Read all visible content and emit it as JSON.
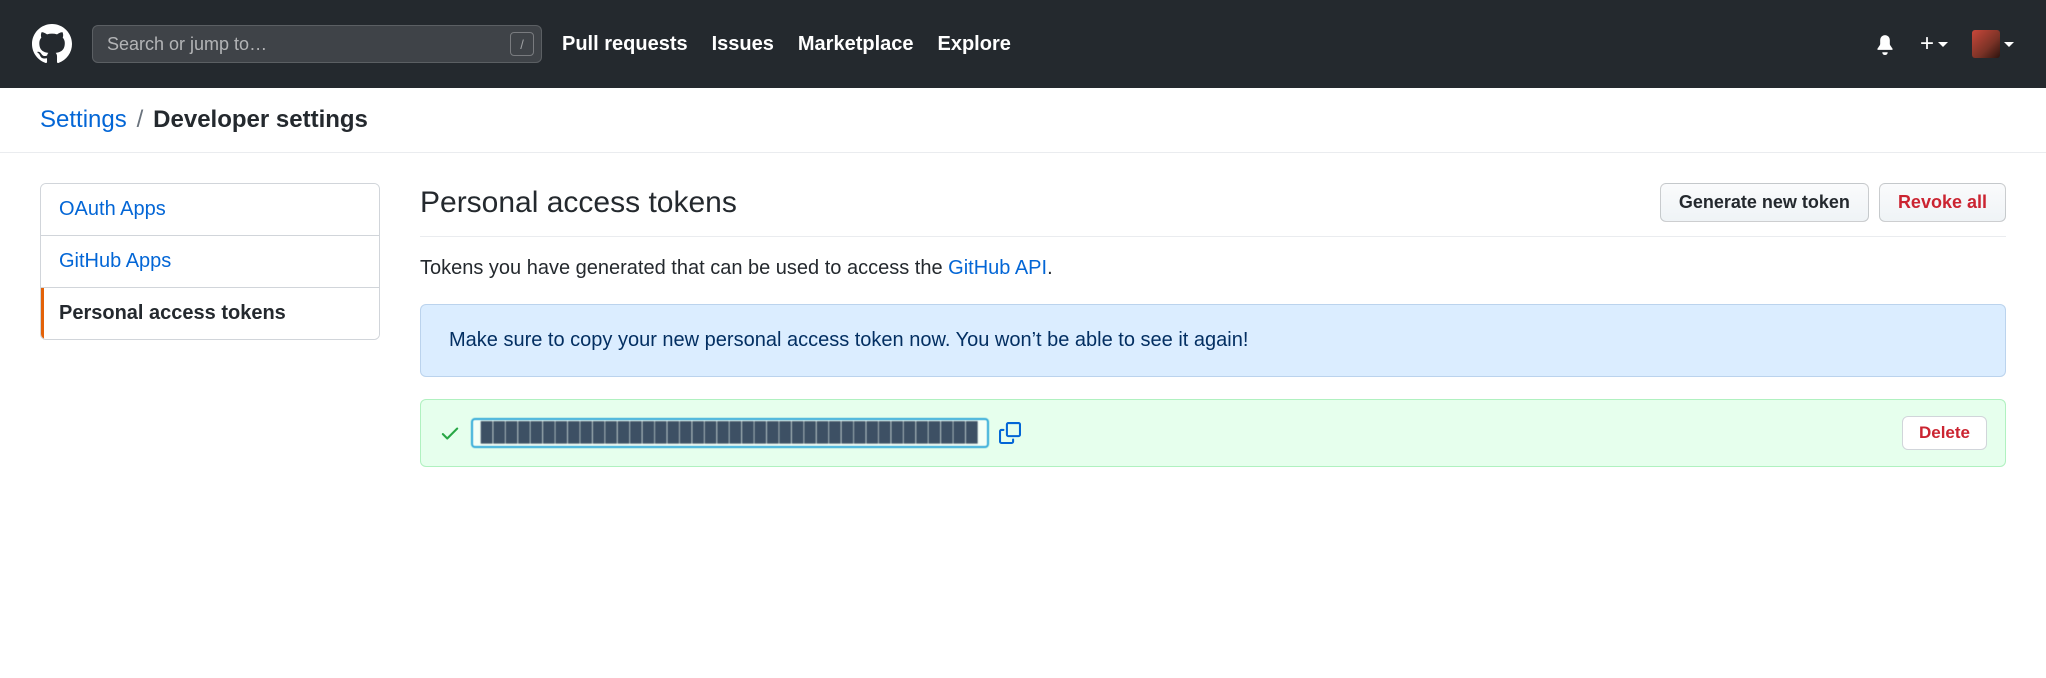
{
  "header": {
    "search_placeholder": "Search or jump to…",
    "nav": [
      "Pull requests",
      "Issues",
      "Marketplace",
      "Explore"
    ]
  },
  "breadcrumb": {
    "parent": "Settings",
    "separator": "/",
    "current": "Developer settings"
  },
  "sidebar": {
    "items": [
      {
        "label": "OAuth Apps",
        "active": false
      },
      {
        "label": "GitHub Apps",
        "active": false
      },
      {
        "label": "Personal access tokens",
        "active": true
      }
    ]
  },
  "main": {
    "title": "Personal access tokens",
    "generate_label": "Generate new token",
    "revoke_label": "Revoke all",
    "intro_prefix": "Tokens you have generated that can be used to access the ",
    "intro_link": "GitHub API",
    "intro_suffix": ".",
    "flash": "Make sure to copy your new personal access token now. You won’t be able to see it again!",
    "token_value": "████████████████████████████████████████",
    "delete_label": "Delete"
  }
}
